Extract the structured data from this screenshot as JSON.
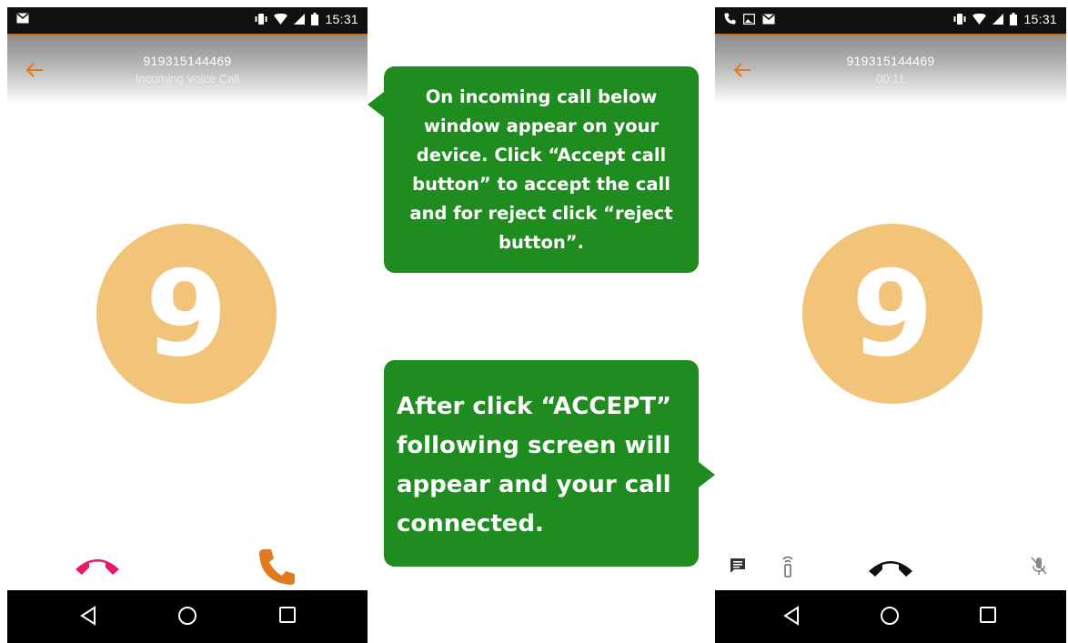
{
  "left_screen": {
    "status_time": "15:31",
    "caller_number": "919315144469",
    "caller_status": "Incoming Voice Call",
    "avatar_letter": "9"
  },
  "right_screen": {
    "status_time": "15:31",
    "caller_number": "919315144469",
    "call_timer": "00:11",
    "avatar_letter": "9"
  },
  "annotations": {
    "incoming_help": "On incoming call below window appear on your device. Click “Accept call button” to accept the call and for reject click “reject button”.",
    "accept_help": "After click “ACCEPT” following screen will appear and your call connected."
  },
  "icons": {
    "status_left": [
      "mail-icon"
    ],
    "status_right_left": [
      "phone-icon",
      "image-icon",
      "mail-icon"
    ],
    "status_system": [
      "vibrate-icon",
      "wifi-icon",
      "signal-icon",
      "battery-icon"
    ],
    "nav": [
      "back-triangle-icon",
      "home-circle-icon",
      "recents-square-icon"
    ],
    "in_call_controls": [
      "chat-icon",
      "speaker-icon",
      "end-call-icon",
      "mute-icon"
    ]
  },
  "colors": {
    "accent_orange": "#e07a1f",
    "reject_pink": "#e8176a",
    "avatar": "#f2c47a",
    "bubble_green": "#1f8c1f",
    "status_bar": "#101010"
  }
}
